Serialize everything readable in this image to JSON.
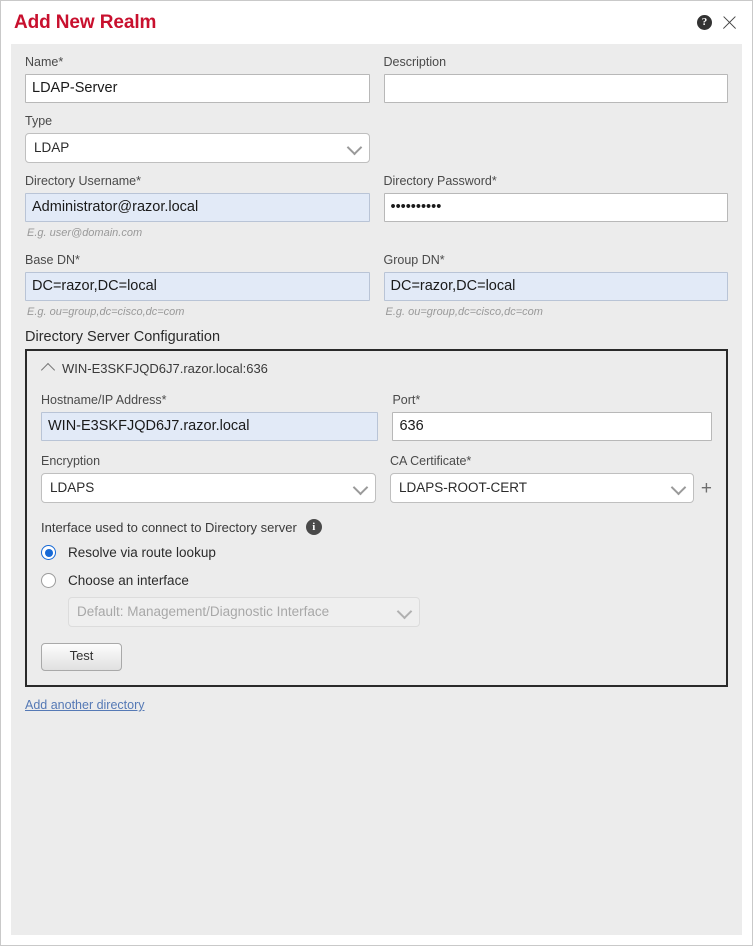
{
  "dialog": {
    "title": "Add New Realm",
    "help_icon": "help-circle-icon",
    "close_icon": "close-icon",
    "accent_color": "#c8102e"
  },
  "form": {
    "name": {
      "label": "Name*",
      "value": "LDAP-Server"
    },
    "description": {
      "label": "Description",
      "value": "",
      "placeholder": ""
    },
    "type": {
      "label": "Type",
      "value": "LDAP"
    },
    "directory_username": {
      "label": "Directory Username*",
      "value": "Administrator@razor.local",
      "hint": "E.g. user@domain.com"
    },
    "directory_password": {
      "label": "Directory Password*",
      "value": "••••••••••"
    },
    "base_dn": {
      "label": "Base DN*",
      "value": "DC=razor,DC=local",
      "hint": "E.g. ou=group,dc=cisco,dc=com"
    },
    "group_dn": {
      "label": "Group DN*",
      "value": "DC=razor,DC=local",
      "hint": "E.g. ou=group,dc=cisco,dc=com"
    }
  },
  "directory_server": {
    "section_title": "Directory Server Configuration",
    "panel_title": "WIN-E3SKFJQD6J7.razor.local:636",
    "collapse_icon": "chevron-up-icon",
    "hostname": {
      "label": "Hostname/IP Address*",
      "value": "WIN-E3SKFJQD6J7.razor.local"
    },
    "port": {
      "label": "Port*",
      "value": "636"
    },
    "encryption": {
      "label": "Encryption",
      "value": "LDAPS"
    },
    "ca_certificate": {
      "label": "CA Certificate*",
      "value": "LDAPS-ROOT-CERT",
      "add_icon": "plus-icon"
    },
    "interface": {
      "label": "Interface used to connect to Directory server",
      "info_icon": "info-circle-icon",
      "option_route_lookup": "Resolve via route lookup",
      "option_choose_interface": "Choose an interface",
      "selected": "route_lookup",
      "interface_select_value": "Default: Management/Diagnostic Interface"
    },
    "test_button": "Test"
  },
  "footer": {
    "add_another": "Add another directory"
  }
}
